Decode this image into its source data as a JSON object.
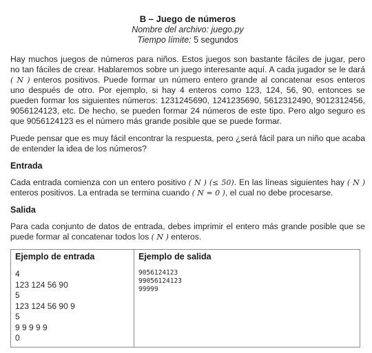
{
  "header": {
    "title": "B – Juego de números",
    "file_line": "Nombre del archivo: juego.py",
    "time_label": "Tiempo límite:",
    "time_value": " 5 segundos"
  },
  "intro": {
    "p1": "Hay muchos juegos de números para niños. Estos juegos son bastante fáciles de jugar, pero no tan fáciles de crear. Hablaremos sobre un juego interesante aquí. A cada jugador se le dará",
    "n_symbol": "( N )",
    "p1_b": "enteros positivos. Puede formar un número entero grande al concatenar esos enteros uno después de otro. Por ejemplo, si hay 4 enteros como 123, 124, 56, 90, entonces se pueden formar los siguientes números: 1231245690, 1241235690, 5612312490, 9012312456, 9056124123, etc. De hecho, se pueden formar 24 números de este tipo. Pero algo seguro es que 9056124123 es el número más grande posible que se puede formar.",
    "p2": "Puede pensar que es muy fácil encontrar la respuesta, pero ¿será fácil para un niño que acaba de entender la idea de los números?"
  },
  "entrada": {
    "heading": "Entrada",
    "t1": "Cada entrada comienza con un entero positivo",
    "m1": "( N ) (≤ 50).",
    "t2": " En las líneas siguientes hay",
    "m2": "( N )",
    "t3": " enteros positivos. La entrada se termina cuando",
    "m3": "( N = 0 )",
    "t4": ", el cual no debe procesarse."
  },
  "salida": {
    "heading": "Salida",
    "t1": "Para cada conjunto de datos de entrada, debes imprimir el entero más grande posible que se puede formar al concatenar todos los",
    "m1": "( N )",
    "t2": " enteros."
  },
  "examples": {
    "input_title": "Ejemplo de entrada",
    "output_title": "Ejemplo de salida",
    "input_lines": [
      "4",
      "123 124 56 90",
      "5",
      "123 124 56 90 9",
      "5",
      "9 9 9 9 9",
      "0"
    ],
    "output_lines": [
      "9056124123",
      "99056124123",
      "99999"
    ]
  }
}
